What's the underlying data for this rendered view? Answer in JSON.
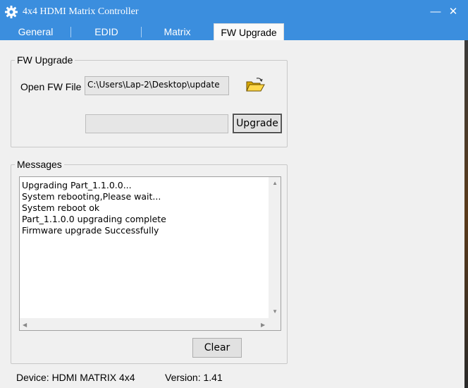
{
  "window": {
    "title": "4x4 HDMI Matrix Controller",
    "minimize_glyph": "—",
    "close_glyph": "✕",
    "app_icon": "gear-icon"
  },
  "tabs": [
    {
      "label": "General",
      "selected": false
    },
    {
      "label": "EDID",
      "selected": false
    },
    {
      "label": "Matrix",
      "selected": false
    },
    {
      "label": "FW Upgrade",
      "selected": true
    }
  ],
  "fw_upgrade": {
    "group_label": "FW Upgrade",
    "open_label": "Open FW File",
    "file_path": "C:\\Users\\Lap-2\\Desktop\\update",
    "folder_icon": "open-folder-icon",
    "progress": 0,
    "upgrade_label": "Upgrade"
  },
  "messages": {
    "group_label": "Messages",
    "lines": [
      "Upgrading Part_1.1.0.0...",
      "System rebooting,Please wait...",
      "System reboot ok",
      "Part_1.1.0.0 upgrading complete",
      "Firmware upgrade Successfully"
    ],
    "clear_label": "Clear"
  },
  "status": {
    "device": "Device: HDMI MATRIX 4x4",
    "version": "Version: 1.41"
  },
  "colors": {
    "titlebar": "#3b8ede",
    "progress_fill": "#06b025"
  }
}
